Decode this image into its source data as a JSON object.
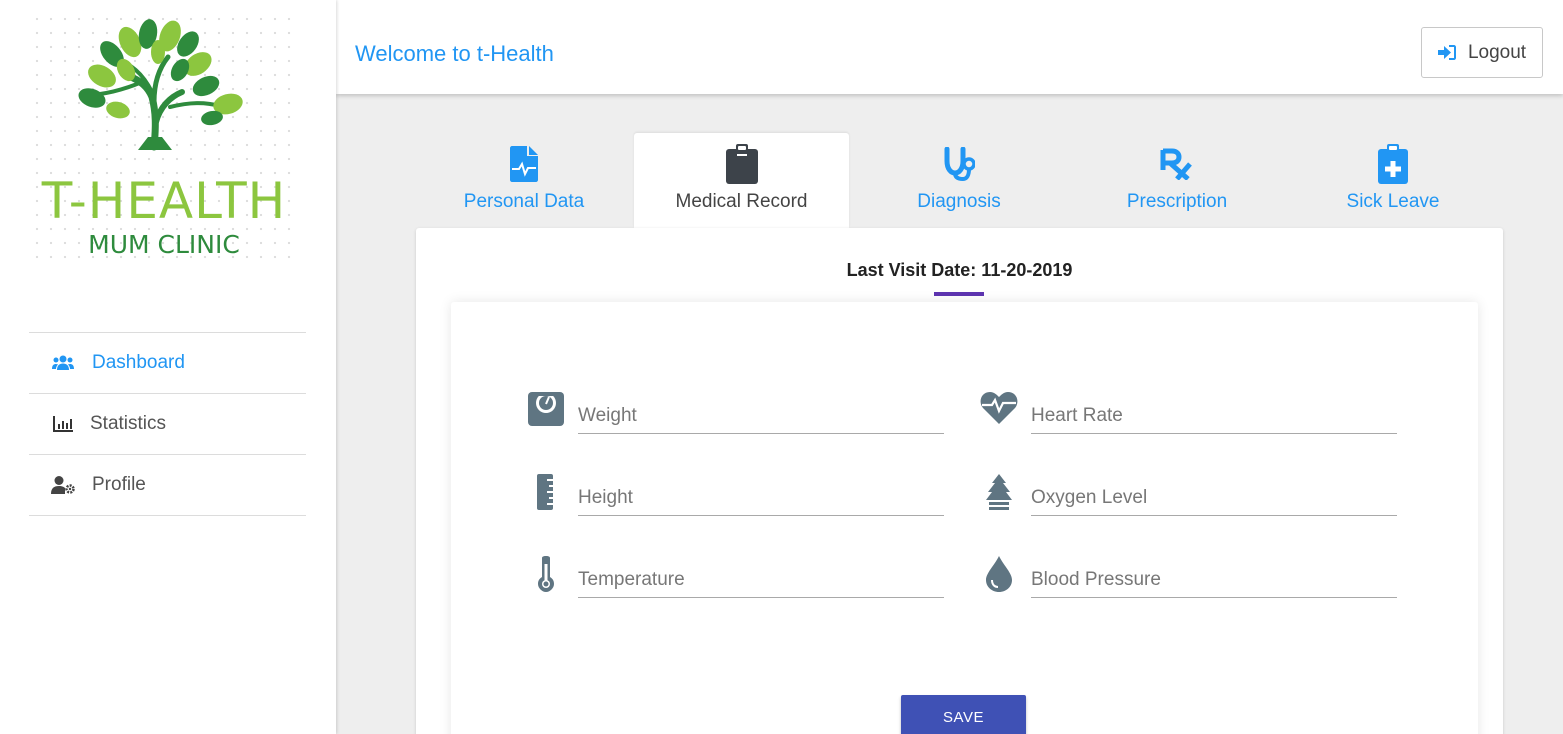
{
  "app": {
    "logo_title": "T-HEALTH",
    "logo_subtitle": "MUM CLINIC",
    "welcome": "Welcome to t-Health",
    "logout_label": "Logout"
  },
  "sidebar": {
    "items": [
      {
        "label": "Dashboard",
        "icon": "users-icon",
        "active": true
      },
      {
        "label": "Statistics",
        "icon": "bar-chart-icon",
        "active": false
      },
      {
        "label": "Profile",
        "icon": "user-cog-icon",
        "active": false
      }
    ]
  },
  "tabs": [
    {
      "label": "Personal Data",
      "icon": "file-medical-icon",
      "active": false
    },
    {
      "label": "Medical Record",
      "icon": "clipboard-icon",
      "active": true
    },
    {
      "label": "Diagnosis",
      "icon": "stethoscope-icon",
      "active": false
    },
    {
      "label": "Prescription",
      "icon": "prescription-icon",
      "active": false
    },
    {
      "label": "Sick Leave",
      "icon": "clipboard-medical-icon",
      "active": false
    }
  ],
  "record": {
    "last_visit": "Last Visit Date: 11-20-2019",
    "fields": {
      "weight": {
        "placeholder": "Weight",
        "icon": "weight-scale-icon"
      },
      "heart_rate": {
        "placeholder": "Heart Rate",
        "icon": "heartbeat-icon"
      },
      "height": {
        "placeholder": "Height",
        "icon": "ruler-icon"
      },
      "oxygen": {
        "placeholder": "Oxygen Level",
        "icon": "air-freshener-icon"
      },
      "temperature": {
        "placeholder": "Temperature",
        "icon": "thermometer-icon"
      },
      "blood_pressure": {
        "placeholder": "Blood Pressure",
        "icon": "droplet-icon"
      }
    },
    "save_label": "SAVE"
  },
  "colors": {
    "accent": "#2196f3",
    "logo_light_green": "#8cc63f",
    "logo_dark_green": "#2e8b3d",
    "save_button": "#3f51b5",
    "visit_underline": "#5e35b1",
    "field_icon": "#5f7582"
  }
}
